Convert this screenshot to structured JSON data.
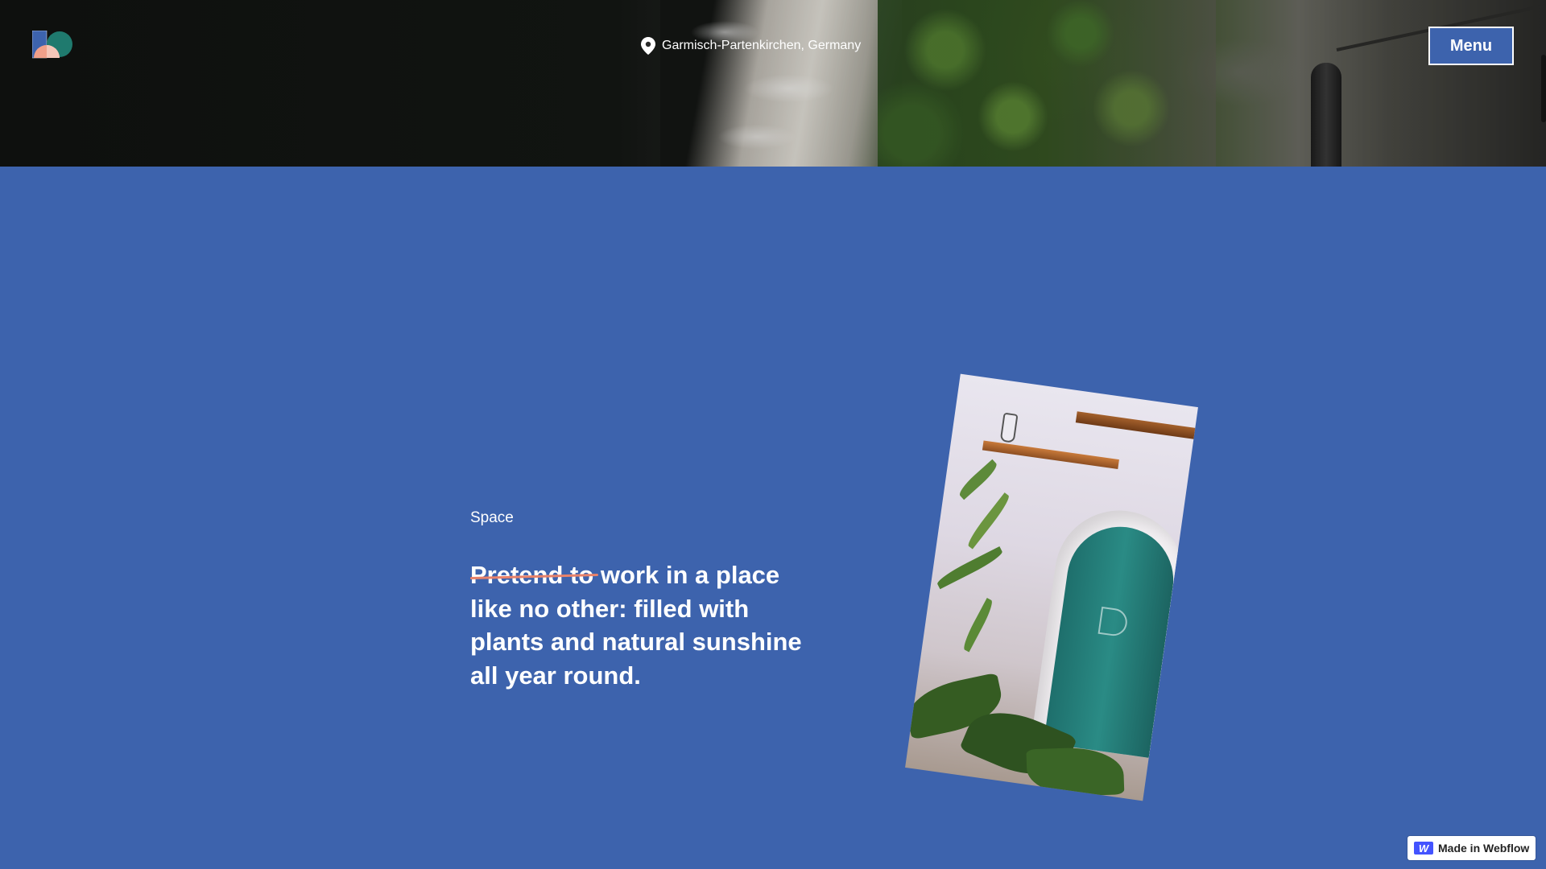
{
  "header": {
    "location": "Garmisch-Partenkirchen, Germany",
    "menu_label": "Menu"
  },
  "section": {
    "eyebrow": "Space",
    "headline_struck": "Pretend to",
    "headline_rest": " work in a place like no other: filled with plants and natural sunshine all year round."
  },
  "badge": {
    "mark": "W",
    "label": "Made in Webflow"
  },
  "colors": {
    "background": "#3d63ad",
    "strike": "#e8826a",
    "webflow": "#4353ff",
    "logo_blue": "#3d63ad",
    "logo_teal": "#1f7a6e",
    "logo_peach": "#f0a08a"
  }
}
